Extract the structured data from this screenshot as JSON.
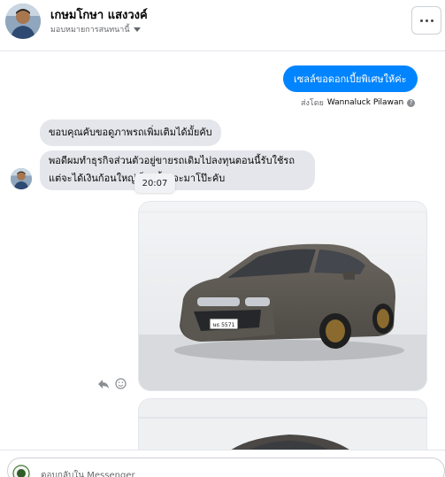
{
  "header": {
    "name": "เกษมโกษา แสงวงค์",
    "assign_label": "มอบหมายการสนทนานี้",
    "more_icon": "more-options-icon"
  },
  "messages": {
    "outgoing_text": "เซลล์ขอดอกเบี้ยพิเศษให้ค่ะ",
    "sent_by_prefix": "ส่งโดย",
    "sent_by_name": "Wannaluck Pilawan",
    "incoming_1": "ขอบคุณคับขอดูภาพรถเพิ่มเติมได้มั้ยคับ",
    "incoming_2": "พอดีผมทำธุรกิจส่วนตัวอยู่ขายรถเดิมไปลงทุนตอนนี้รับใช้รถแต่จะได้เงินก้อนใหญ่เร็วๆนี้ว่าจะมาโป๊ะคับ",
    "timestamp": "20:07",
    "plate_text": "ษธ 5571"
  },
  "composer": {
    "placeholder": "ตอบกลับใน Messenger"
  },
  "colors": {
    "accent": "#0084ff",
    "incoming_bubble": "#e4e6eb",
    "car_body": "#5b5650"
  }
}
